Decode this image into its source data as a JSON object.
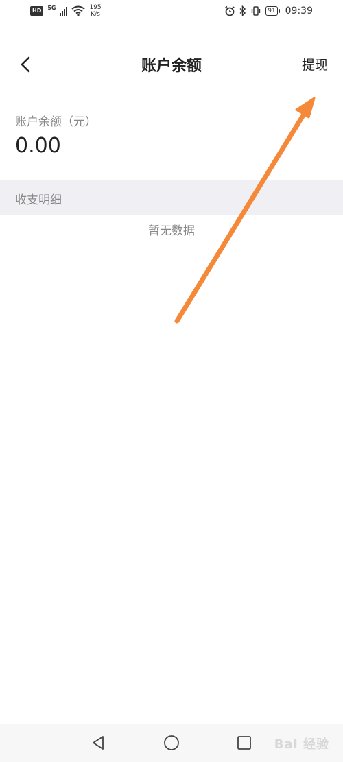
{
  "status_bar": {
    "hd": "HD",
    "network_gen": "5G",
    "speed_value": "195",
    "speed_unit": "K/s",
    "battery": "91",
    "time": "09:39"
  },
  "header": {
    "title": "账户余额",
    "withdraw_label": "提现"
  },
  "balance": {
    "label": "账户余额（元）",
    "value": "0.00"
  },
  "records": {
    "section_title": "收支明细",
    "empty_text": "暂无数据"
  },
  "annotation": {
    "arrow_color": "#f5893a"
  },
  "watermark": {
    "text": "Bai 经验"
  }
}
